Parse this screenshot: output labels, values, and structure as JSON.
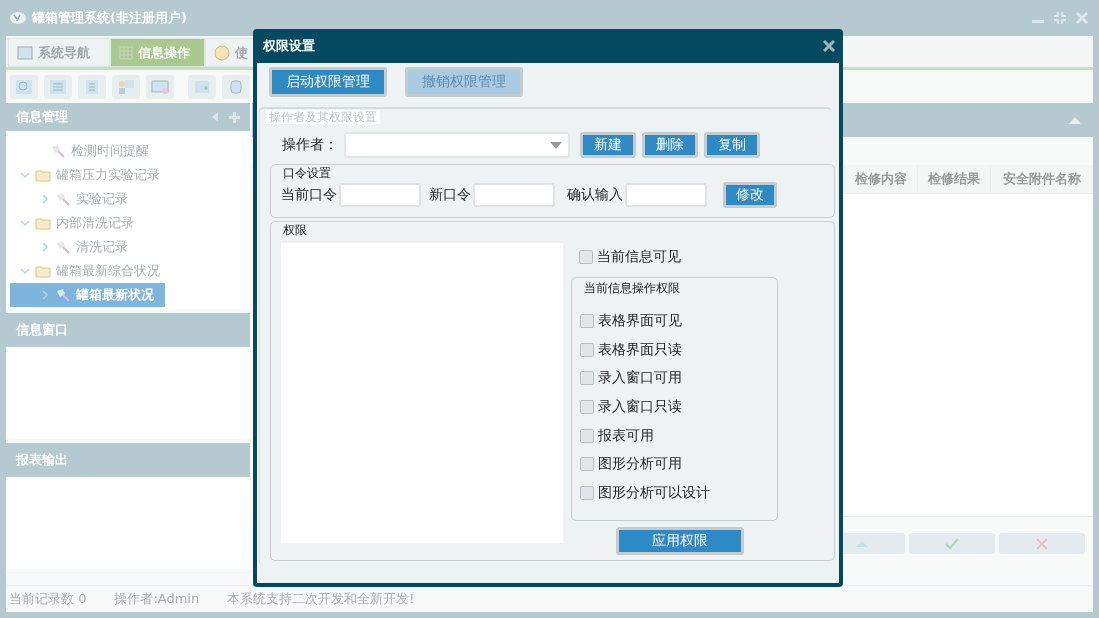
{
  "window": {
    "title": "罐箱管理系统(非注册用户)"
  },
  "tabs": [
    {
      "label": "系统导航",
      "selected": false
    },
    {
      "label": "信息操作",
      "selected": true
    },
    {
      "label": "使",
      "selected": false
    }
  ],
  "sidebar": {
    "sections": [
      {
        "title": "信息管理",
        "tree": [
          {
            "label": "检测时间提醒",
            "kind": "leaf",
            "selected": false
          },
          {
            "label": "罐箱压力实验记录",
            "kind": "folder",
            "expanded": true,
            "selected": false,
            "children": [
              {
                "label": "实验记录",
                "kind": "leaf",
                "expanded": false,
                "selected": false
              }
            ]
          },
          {
            "label": "内部清洗记录",
            "kind": "folder",
            "expanded": true,
            "selected": false,
            "children": [
              {
                "label": "清洗记录",
                "kind": "leaf",
                "expanded": false,
                "selected": false
              }
            ]
          },
          {
            "label": "罐箱最新综合状况",
            "kind": "folder",
            "expanded": true,
            "selected": false,
            "children": [
              {
                "label": "罐箱最新状况",
                "kind": "leaf",
                "expanded": false,
                "selected": true
              }
            ]
          }
        ]
      },
      {
        "title": "信息窗口"
      },
      {
        "title": "报表输出"
      }
    ]
  },
  "table": {
    "columns": [
      "检修内容",
      "检修结果",
      "安全附件名称"
    ]
  },
  "status_bar": [
    "当前记录数 0",
    "操作者:Admin",
    "本系统支持二次开发和全新开发!"
  ],
  "dialog": {
    "title": "权限设置",
    "buttons": [
      {
        "label": "启动权限管理",
        "disabled": false
      },
      {
        "label": "撤销权限管理",
        "disabled": true
      }
    ],
    "operator_group": {
      "legend": "操作者及其权限设置",
      "operator_label": "操作者：",
      "actions": [
        "新建",
        "删除",
        "复制"
      ]
    },
    "password_group": {
      "legend": "口令设置",
      "fields": [
        {
          "label": "当前口令"
        },
        {
          "label": "新口令"
        },
        {
          "label": "确认输入"
        }
      ],
      "action": "修改"
    },
    "permission_group": {
      "legend": "权限",
      "visible_option": {
        "label": "当前信息可见",
        "checked": false
      },
      "ops_legend": "当前信息操作权限",
      "options": [
        {
          "label": "表格界面可见",
          "checked": false
        },
        {
          "label": "表格界面只读",
          "checked": false
        },
        {
          "label": "录入窗口可用",
          "checked": false
        },
        {
          "label": "录入窗口只读",
          "checked": false
        },
        {
          "label": "报表可用",
          "checked": false
        },
        {
          "label": "图形分析可用",
          "checked": false
        },
        {
          "label": "图形分析可以设计",
          "checked": false
        }
      ],
      "apply": "应用权限"
    }
  }
}
